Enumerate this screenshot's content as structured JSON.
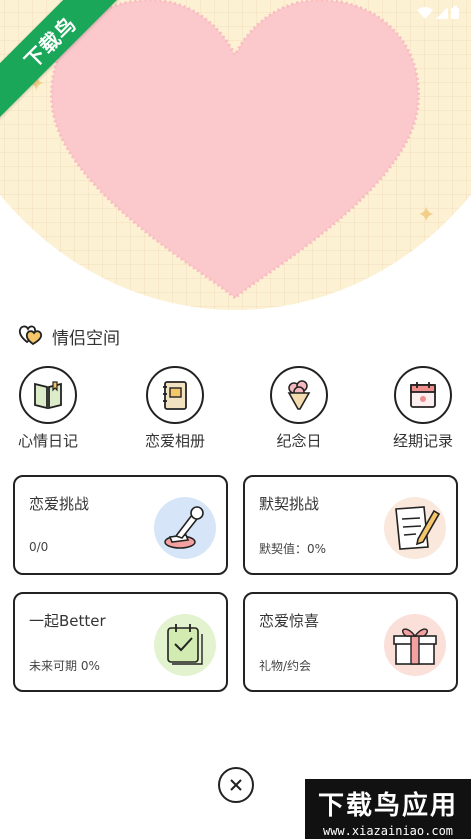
{
  "status_bar": {
    "icons": [
      "wifi-icon",
      "signal-icon",
      "battery-icon"
    ]
  },
  "watermark": {
    "corner": "下载鸟",
    "bottom_main": "下载鸟应用",
    "bottom_url": "www.xiazainiao.com"
  },
  "section": {
    "title": "情侣空间",
    "icon": "double-heart-icon"
  },
  "quick_actions": [
    {
      "label": "心情日记",
      "icon": "notebook-icon"
    },
    {
      "label": "恋爱相册",
      "icon": "album-icon"
    },
    {
      "label": "纪念日",
      "icon": "bouquet-icon"
    },
    {
      "label": "经期记录",
      "icon": "calendar-icon"
    }
  ],
  "cards": [
    {
      "title": "恋爱挑战",
      "subtitle": "0/0",
      "icon": "stamp-icon",
      "icon_bg": "#d6e6f8"
    },
    {
      "title": "默契挑战",
      "subtitle": "默契值：0%",
      "icon": "note-pencil-icon",
      "icon_bg": "#fbe8dc"
    },
    {
      "title": "一起Better",
      "subtitle": "未来可期 0%",
      "icon": "checklist-icon",
      "icon_bg": "#e3f2cf"
    },
    {
      "title": "恋爱惊喜",
      "subtitle": "礼物/约会",
      "icon": "gift-icon",
      "icon_bg": "#fbe0da"
    }
  ],
  "close": {
    "icon": "close-icon"
  },
  "colors": {
    "hero_bg": "#fdf1d4",
    "heart": "#fbc8cb",
    "sparkle": "#f1cf88",
    "border": "#222222",
    "ribbon": "#1aa75a"
  }
}
